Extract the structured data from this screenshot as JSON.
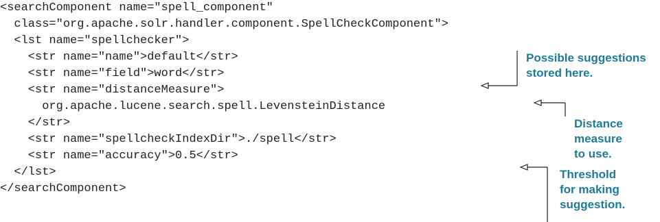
{
  "code_lines": [
    "<searchComponent name=\"spell_component\"",
    "  class=\"org.apache.solr.handler.component.SpellCheckComponent\">",
    "  <lst name=\"spellchecker\">",
    "    <str name=\"name\">default</str>",
    "    <str name=\"field\">word</str>",
    "    <str name=\"distanceMeasure\">",
    "      org.apache.lucene.search.spell.LevensteinDistance",
    "    </str>",
    "    <str name=\"spellcheckIndexDir\">./spell</str>",
    "    <str name=\"accuracy\">0.5</str>",
    "  </lst>",
    "</searchComponent>"
  ],
  "annotations": {
    "suggestions": "Possible suggestions\nstored here.",
    "distance": "Distance\nmeasure\nto use.",
    "threshold": "Threshold\nfor making\nsuggestion."
  },
  "colors": {
    "code_text": "#222222",
    "annotation_text": "#1f7a99",
    "callout_line": "#222222"
  }
}
